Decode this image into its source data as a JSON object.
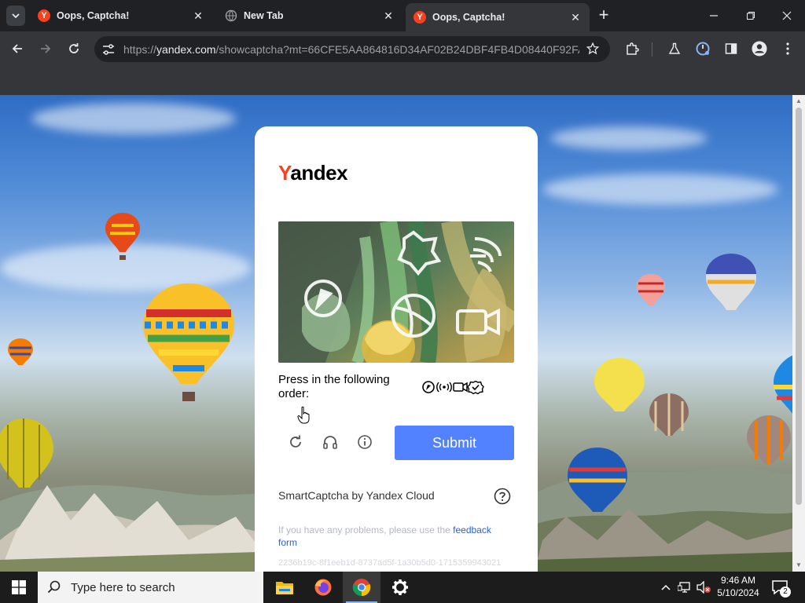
{
  "browser": {
    "tabs": [
      {
        "title": "Oops, Captcha!",
        "favicon": "yandex-favicon",
        "active": false
      },
      {
        "title": "New Tab",
        "favicon": "globe-icon",
        "active": false
      },
      {
        "title": "Oops, Captcha!",
        "favicon": "yandex-favicon",
        "active": true
      }
    ],
    "url_prefix": "https://",
    "url_host": "yandex.com",
    "url_path": "/showcaptcha?mt=66CFE5AA864816D34AF02B24DBF4FB4D08440F92FA...",
    "favicon_letter": "Y"
  },
  "captcha": {
    "logo_first": "Y",
    "logo_rest": "andex",
    "instruction": "Press in the following order:",
    "order_icons": [
      "compass-icon",
      "radio-waves-icon",
      "video-camera-icon",
      "check-badge-icon"
    ],
    "submit_label": "Submit",
    "provider": "SmartCaptcha by Yandex Cloud",
    "problems_text": "If you have any problems, please use the ",
    "feedback_link": "feedback form",
    "hash": "2236b19c-8f1eeb1d-8737ad5f-1a30b5d0-1715359943021"
  },
  "taskbar": {
    "search_placeholder": "Type here to search",
    "time": "9:46 AM",
    "date": "5/10/2024",
    "notification_count": "2"
  },
  "colors": {
    "yandex_red": "#fc3f1d",
    "submit_blue": "#5282ff",
    "link_blue": "#2b5fd9"
  }
}
